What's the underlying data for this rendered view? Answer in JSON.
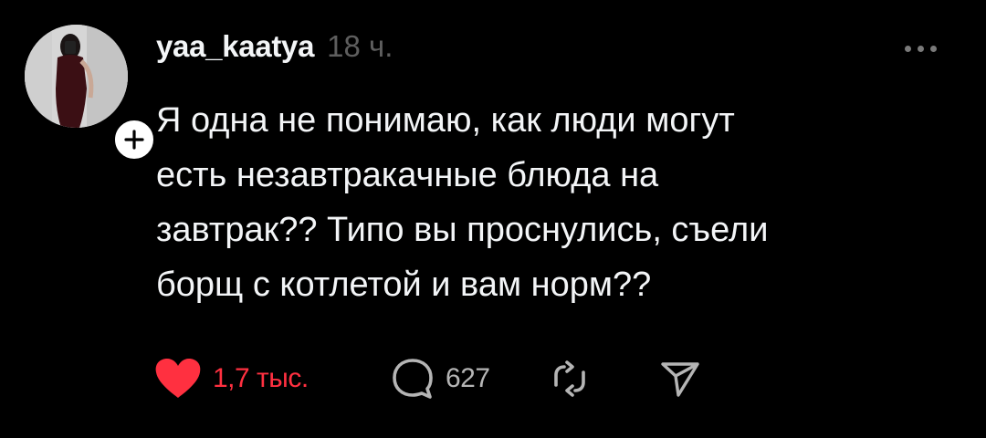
{
  "post": {
    "username": "yaa_kaatya",
    "time": "18 ч.",
    "text": "Я одна не понимаю, как люди могут\nесть незавтракачные блюда на\nзавтрак?? Типо вы проснулись, съели\nборщ с котлетой и вам норм??",
    "liked": true,
    "likes": "1,7 тыс.",
    "replies": "627"
  },
  "icons": {
    "more": "more-horizontal-icon",
    "follow": "plus-icon",
    "like": "heart-icon",
    "reply": "speech-bubble-icon",
    "repost": "repost-icon",
    "share": "send-icon"
  },
  "colors": {
    "background": "#000000",
    "text": "#f3f5f7",
    "muted": "#5e5e5e",
    "like": "#ff3040",
    "icon": "#b5b5b5"
  }
}
